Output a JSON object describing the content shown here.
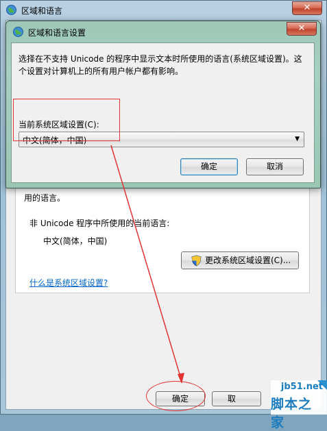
{
  "outer_window": {
    "title": "区域和语言",
    "close_label": "✕",
    "panel": {
      "text_line": "用的语言。",
      "non_unicode_label": "非 Unicode 程序中所使用的当前语言:",
      "current_language": "中文(简体，中国)",
      "change_button_label": "更改系统区域设置(C)...",
      "help_link": "什么是系统区域设置?"
    },
    "ok_label": "确定",
    "cancel_label": "取"
  },
  "dialog": {
    "title": "区域和语言设置",
    "close_label": "✕",
    "description": "选择在不支持 Unicode 的程序中显示文本时所使用的语言(系统区域设置)。这个设置对计算机上的所有用户帐户都有影响。",
    "combo_label": "当前系统区域设置(C):",
    "combo_value": "中文(简体，中国)",
    "ok_label": "确定",
    "cancel_label": "取消"
  },
  "watermark": {
    "top": "jb51.net",
    "bottom": "脚本之家"
  },
  "colors": {
    "annotation": "#e23232",
    "link": "#0066cc",
    "watermark": "#1b7dbf"
  },
  "icons": {
    "window": "globe-icon",
    "uac": "shield-icon",
    "dropdown": "chevron-down-icon"
  }
}
